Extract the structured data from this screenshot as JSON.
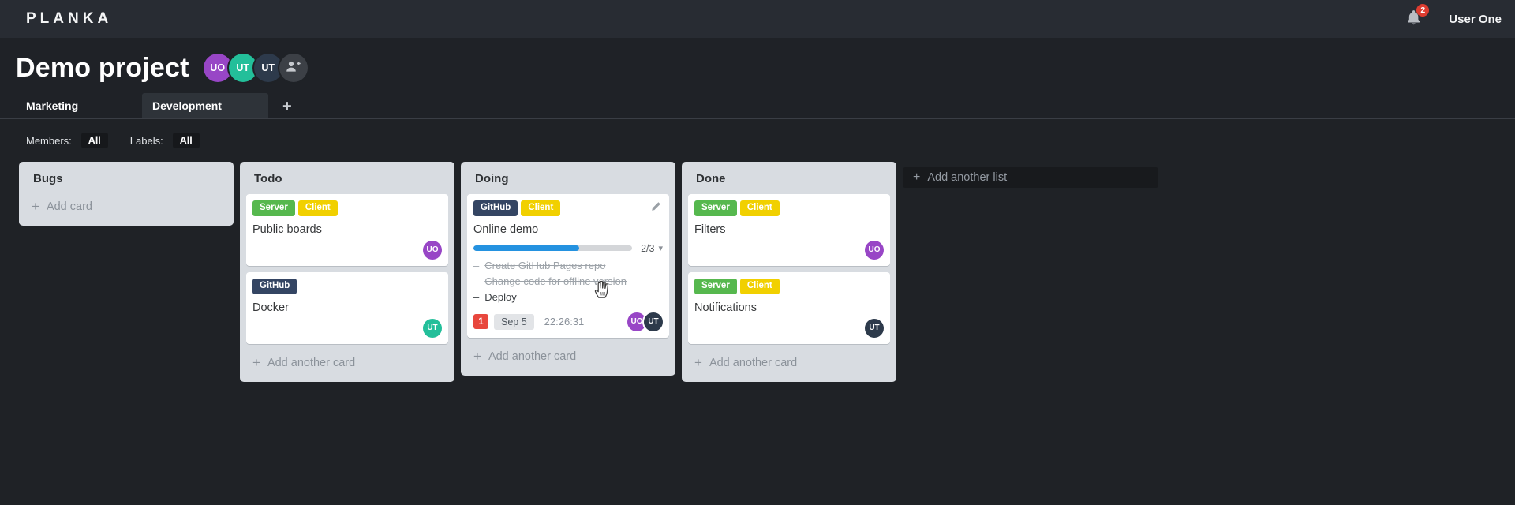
{
  "header": {
    "logo": "PLANKA",
    "notification_count": "2",
    "user_name": "User One"
  },
  "project": {
    "title": "Demo project",
    "members": [
      {
        "initials": "UO",
        "color": "#9846c6"
      },
      {
        "initials": "UT",
        "color": "#23bf9a"
      },
      {
        "initials": "UT",
        "color": "#2d3a4b"
      }
    ]
  },
  "tabs": {
    "items": [
      {
        "label": "Marketing"
      },
      {
        "label": "Development"
      }
    ],
    "active_index": 1
  },
  "filters": {
    "members_label": "Members:",
    "members_value": "All",
    "labels_label": "Labels:",
    "labels_value": "All"
  },
  "icons": {
    "plus": "+",
    "caret_down": "▾",
    "task_dash": "–"
  },
  "board": {
    "add_list_label": "Add another list",
    "lists": [
      {
        "title": "Bugs",
        "add_label": "Add card",
        "cards": []
      },
      {
        "title": "Todo",
        "add_label": "Add another card",
        "cards": [
          {
            "title": "Public boards",
            "labels": [
              {
                "text": "Server",
                "color": "#56b84e"
              },
              {
                "text": "Client",
                "color": "#f1d000"
              }
            ],
            "members": [
              {
                "initials": "UO",
                "color": "#9846c6"
              }
            ]
          },
          {
            "title": "Docker",
            "labels": [
              {
                "text": "GitHub",
                "color": "#344563"
              }
            ],
            "members": [
              {
                "initials": "UT",
                "color": "#23bf9a"
              }
            ]
          }
        ]
      },
      {
        "title": "Doing",
        "add_label": "Add another card",
        "cards": [
          {
            "title": "Online demo",
            "labels": [
              {
                "text": "GitHub",
                "color": "#344563"
              },
              {
                "text": "Client",
                "color": "#f1d000"
              }
            ],
            "progress": {
              "label": "2/3",
              "percent": 66.7,
              "color": "#2492e0"
            },
            "tasks": [
              {
                "text": "Create GitHub Pages repo",
                "done": true
              },
              {
                "text": "Change code for offline version",
                "done": true
              },
              {
                "text": "Deploy",
                "done": false
              }
            ],
            "badges": {
              "notifications": "1",
              "due_date": "Sep 5",
              "timer": "22:26:31"
            },
            "members": [
              {
                "initials": "UO",
                "color": "#9846c6"
              },
              {
                "initials": "UT",
                "color": "#2d3a4b"
              }
            ]
          }
        ]
      },
      {
        "title": "Done",
        "add_label": "Add another card",
        "cards": [
          {
            "title": "Filters",
            "labels": [
              {
                "text": "Server",
                "color": "#56b84e"
              },
              {
                "text": "Client",
                "color": "#f1d000"
              }
            ],
            "members": [
              {
                "initials": "UO",
                "color": "#9846c6"
              }
            ]
          },
          {
            "title": "Notifications",
            "labels": [
              {
                "text": "Server",
                "color": "#56b84e"
              },
              {
                "text": "Client",
                "color": "#f1d000"
              }
            ],
            "members": [
              {
                "initials": "UT",
                "color": "#2d3a4b"
              }
            ]
          }
        ]
      }
    ]
  }
}
